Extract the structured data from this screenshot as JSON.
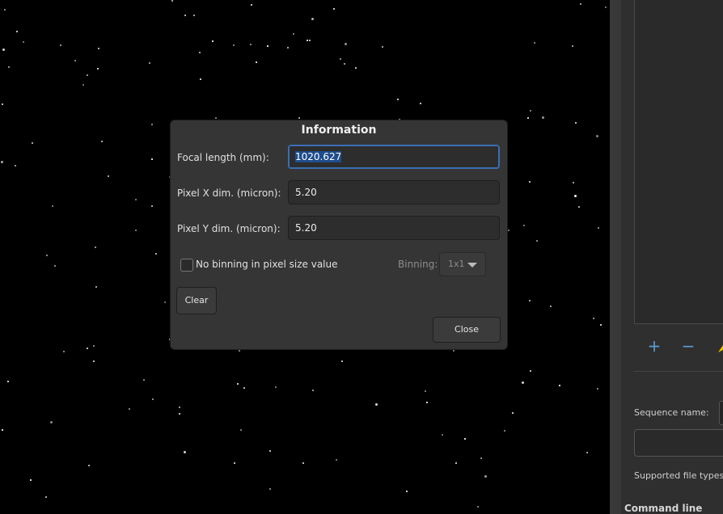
{
  "dialog": {
    "title": "Information",
    "focal_length": {
      "label": "Focal length (mm):",
      "value": "1020.627"
    },
    "pixel_x": {
      "label": "Pixel X dim. (micron):",
      "value": "5.20"
    },
    "pixel_y": {
      "label": "Pixel Y dim. (micron):",
      "value": "5.20"
    },
    "no_binning": {
      "label": "No binning in pixel size value",
      "checked": false
    },
    "binning": {
      "label": "Binning:",
      "value": "1x1"
    },
    "clear_label": "Clear",
    "close_label": "Close"
  },
  "side_panel": {
    "add_icon_glyph": "+",
    "remove_icon_glyph": "−",
    "sequence_name_label": "Sequence name:",
    "supported_file_types_label": "Supported file types",
    "command_line_label": "Command line"
  },
  "colors": {
    "accent": "#3a6fb5",
    "selection": "#1e4d8c",
    "dialog_bg": "#353535"
  }
}
